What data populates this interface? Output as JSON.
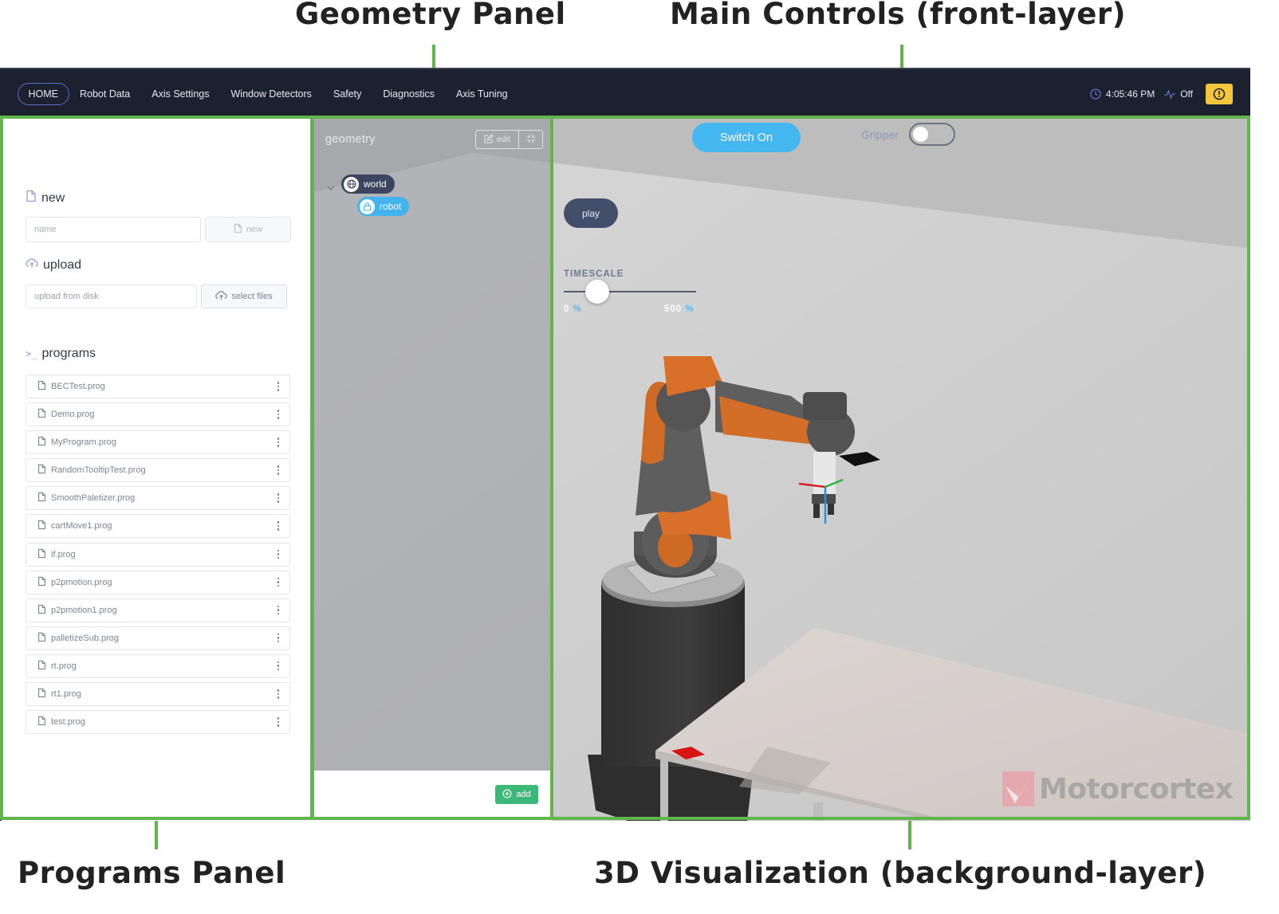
{
  "annotations": {
    "geometry_panel": "Geometry Panel",
    "main_controls": "Main Controls (front-layer)",
    "programs_panel": "Programs Panel",
    "visualization": "3D Visualization (background-layer)"
  },
  "topbar": {
    "nav": [
      {
        "label": "HOME",
        "active": true
      },
      {
        "label": "Robot Data",
        "active": false
      },
      {
        "label": "Axis Settings",
        "active": false
      },
      {
        "label": "Window Detectors",
        "active": false
      },
      {
        "label": "Safety",
        "active": false
      },
      {
        "label": "Diagnostics",
        "active": false
      },
      {
        "label": "Axis Tuning",
        "active": false
      }
    ],
    "time": "4:05:46 PM",
    "activity_status": "Off",
    "icons": {
      "clock": "clock-icon",
      "activity": "activity-pulse-icon",
      "alert": "alert-circle-icon"
    },
    "colors": {
      "bar_bg": "#1c2130",
      "active_outline": "#5d6fc4",
      "alert_bg": "#f3c63c"
    }
  },
  "programs": {
    "new_section": {
      "title": "new",
      "name_placeholder": "name",
      "new_button": "new"
    },
    "upload_section": {
      "title": "upload",
      "upload_placeholder": "upload from disk",
      "select_button": "select files"
    },
    "programs_section": {
      "title": "programs"
    },
    "files": [
      "BECTest.prog",
      "Demo.prog",
      "MyProgram.prog",
      "RandomTooltipTest.prog",
      "SmoothPaletizer.prog",
      "cartMove1.prog",
      "if.prog",
      "p2pmotion.prog",
      "p2pmotion1.prog",
      "palletizeSub.prog",
      "rt.prog",
      "rt1.prog",
      "test.prog"
    ]
  },
  "geometry": {
    "title": "geometry",
    "edit_button": "edit",
    "tree": {
      "root": "world",
      "child": "robot"
    },
    "add_button": "add",
    "colors": {
      "world_node": "#3c4560",
      "robot_node": "#43b3ee",
      "add_button": "#3cb878"
    }
  },
  "main_controls": {
    "switch_on_button": "Switch On",
    "gripper_label": "Gripper",
    "gripper_on": false,
    "play_button": "play",
    "timescale": {
      "label": "TIMESCALE",
      "min": 0,
      "max": 500,
      "min_label": "0",
      "max_label": "500",
      "unit": "%",
      "value": 125
    },
    "colors": {
      "switch_on": "#44b6f0",
      "play": "#424e6a"
    }
  },
  "visualization": {
    "watermark": "Motorcortex",
    "colors": {
      "robot_orange": "#d9702a",
      "robot_gray": "#5a5a5a",
      "pedestal": "#3a3a3a",
      "table": "#d9d3d0",
      "block": "#d81414",
      "panel_outline": "#62b54a"
    }
  }
}
